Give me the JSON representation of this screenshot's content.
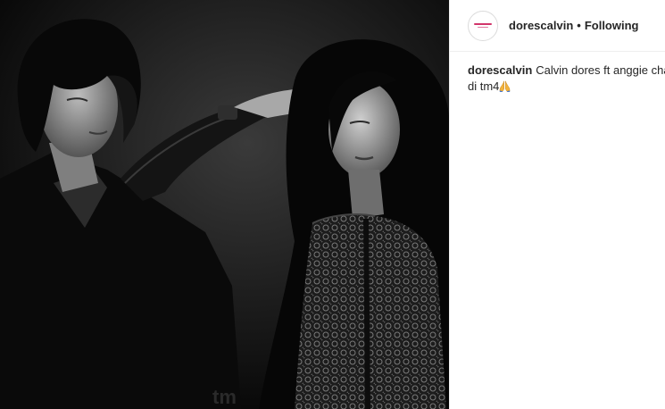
{
  "post": {
    "author": {
      "username": "dorescalvin",
      "separator": "•",
      "follow_state": "Following"
    },
    "caption": {
      "username": "dorescalvin",
      "line1": "Calvin dores ft anggie chan jal",
      "line2": "di tm4",
      "emoji_icon": "folded-hands-icon"
    },
    "photo": {
      "style": "black-and-white",
      "watermark": "tm"
    },
    "colors": {
      "text": "#262626",
      "divider": "#efefef",
      "avatar_accent": "#d1356b"
    }
  }
}
